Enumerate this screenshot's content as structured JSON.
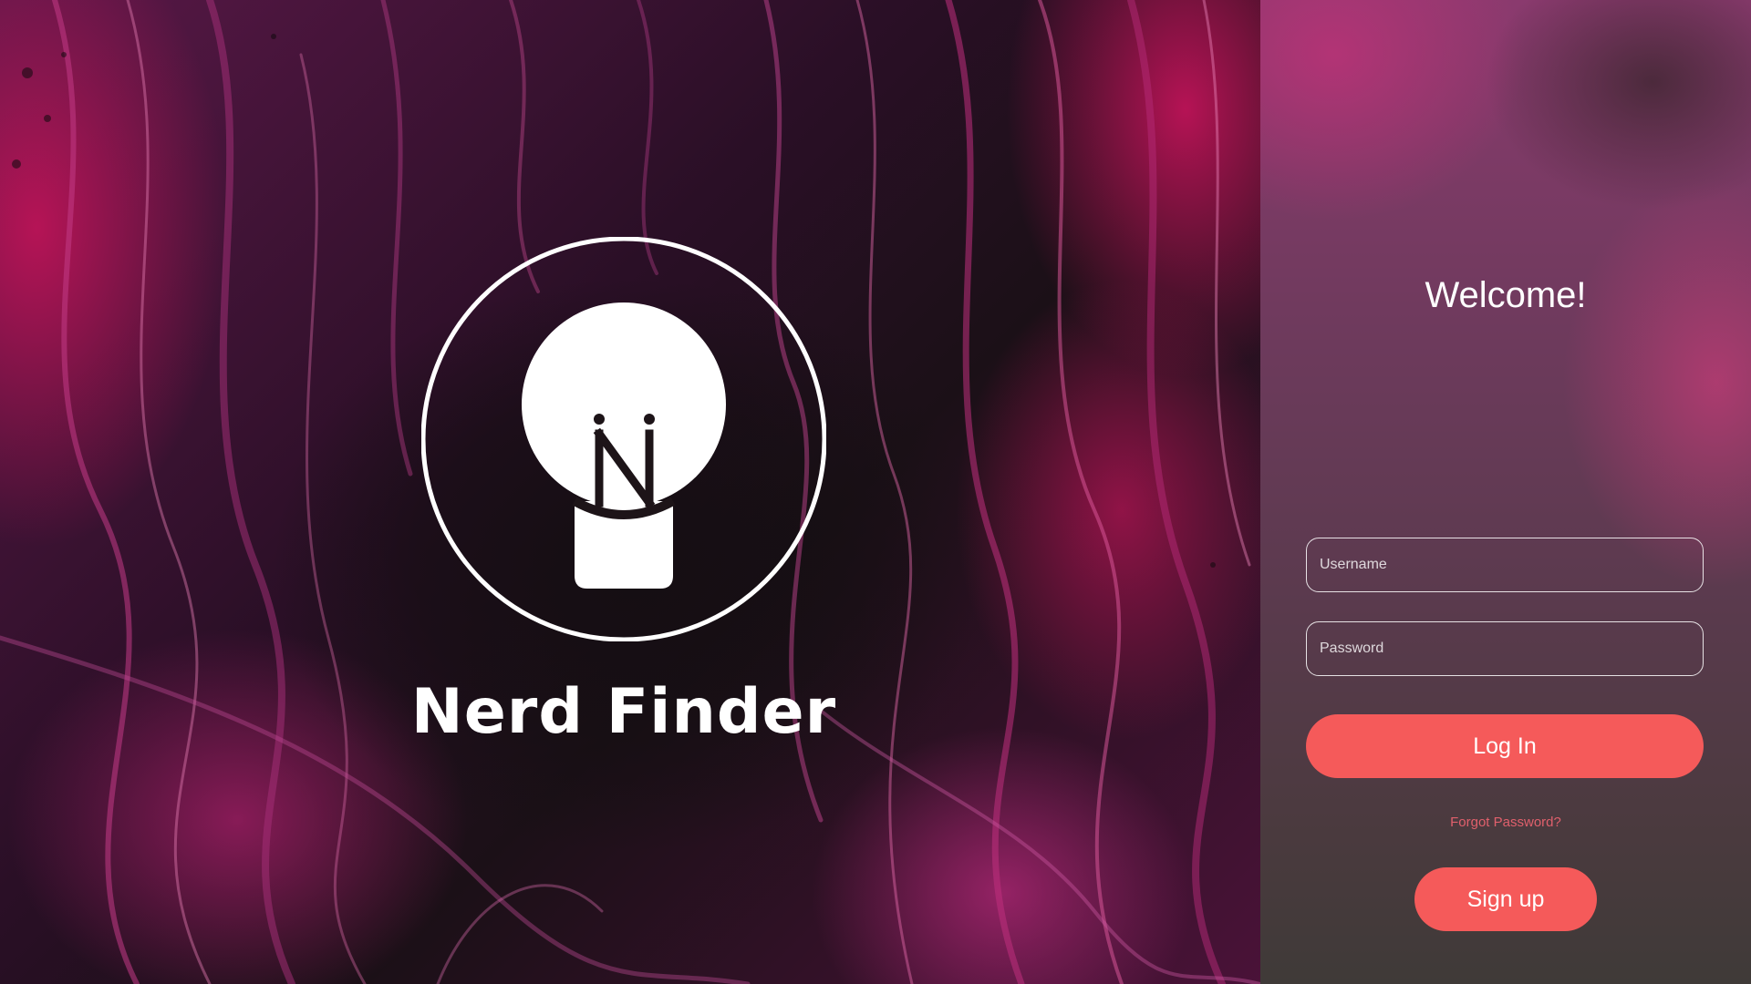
{
  "brand": {
    "name": "Nerd Finder",
    "logo_icon": "lightbulb-icon",
    "logo_monogram": "N"
  },
  "login": {
    "heading": "Welcome!",
    "username_placeholder": "Username",
    "password_placeholder": "Password",
    "login_label": "Log In",
    "forgot_label": "Forgot Password?",
    "signup_label": "Sign up"
  },
  "colors": {
    "accent": "#f55a5a",
    "forgot_link": "#e0606c",
    "text": "#ffffff"
  }
}
